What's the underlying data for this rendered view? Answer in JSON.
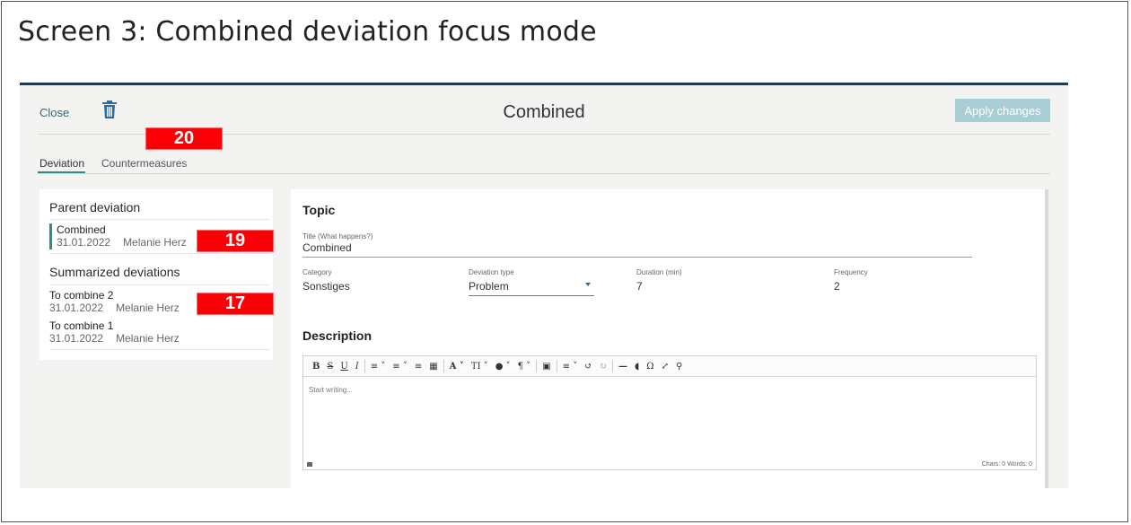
{
  "screen_title": "Screen 3: Combined deviation focus mode",
  "dialog": {
    "close_label": "Close",
    "title": "Combined",
    "apply_label": "Apply changes"
  },
  "tabs": [
    {
      "label": "Deviation",
      "active": true
    },
    {
      "label": "Countermeasures",
      "active": false
    }
  ],
  "badges": {
    "countermeasures": "20",
    "parent": "19",
    "summarized": "17"
  },
  "left_panel": {
    "parent_heading": "Parent deviation",
    "parent": {
      "name": "Combined",
      "date": "31.01.2022",
      "user": "Melanie Herz"
    },
    "summarized_heading": "Summarized deviations",
    "summarized": [
      {
        "name": "To combine 2",
        "date": "31.01.2022",
        "user": "Melanie Herz"
      },
      {
        "name": "To combine 1",
        "date": "31.01.2022",
        "user": "Melanie Herz"
      }
    ]
  },
  "topic": {
    "heading": "Topic",
    "title_label": "Title (What happens?)",
    "title_value": "Combined",
    "category_label": "Category",
    "category_value": "Sonstiges",
    "type_label": "Deviation type",
    "type_value": "Problem",
    "duration_label": "Duration (min)",
    "duration_value": "7",
    "frequency_label": "Frequency",
    "frequency_value": "2"
  },
  "description": {
    "heading": "Description",
    "placeholder": "Start writing...",
    "counter": "Chars: 0  Words: 0"
  },
  "colors": {
    "accent": "#2f8c7f",
    "badge": "#fb0007",
    "apply_button": "#a8cdd5"
  }
}
